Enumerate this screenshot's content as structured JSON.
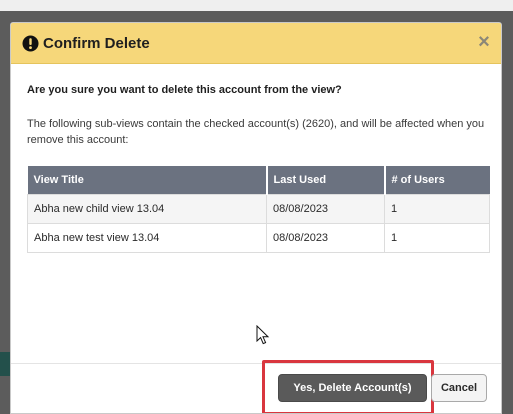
{
  "dialog": {
    "title": "Confirm Delete",
    "close_glyph": "×",
    "icon": "exclamation-circle-icon",
    "question": "Are you sure you want to delete this account from the view?",
    "info": "The following sub-views contain the checked account(s) (2620), and will be affected when you remove this account:"
  },
  "table": {
    "headers": [
      "View Title",
      "Last Used",
      "# of Users"
    ],
    "rows": [
      [
        "Abha new child view 13.04",
        "08/08/2023",
        "1"
      ],
      [
        "Abha new test view 13.04",
        "08/08/2023",
        "1"
      ]
    ]
  },
  "buttons": {
    "confirm_label": "Yes, Delete Account(s)",
    "cancel_label": "Cancel"
  },
  "colors": {
    "header_bg": "#f6d77a",
    "table_header_bg": "#6b7280",
    "confirm_bg": "#5a5a5a",
    "highlight": "#d9363e"
  }
}
